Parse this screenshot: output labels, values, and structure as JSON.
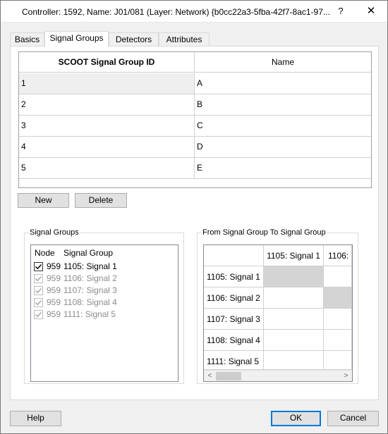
{
  "window": {
    "title": "Controller: 1592, Name: J01/081 (Layer: Network) {b0cc22a3-5fba-42f7-8ac1-97...",
    "help_glyph": "?",
    "close_glyph": "✕"
  },
  "tabs": [
    {
      "label": "Basics",
      "active": false
    },
    {
      "label": "Signal Groups",
      "active": true
    },
    {
      "label": "Detectors",
      "active": false
    },
    {
      "label": "Attributes",
      "active": false
    }
  ],
  "grid": {
    "columns": [
      "SCOOT Signal Group ID",
      "Name"
    ],
    "rows": [
      {
        "id": "1",
        "name": "A",
        "selected": true
      },
      {
        "id": "2",
        "name": "B",
        "selected": false
      },
      {
        "id": "3",
        "name": "C",
        "selected": false
      },
      {
        "id": "4",
        "name": "D",
        "selected": false
      },
      {
        "id": "5",
        "name": "E",
        "selected": false
      }
    ]
  },
  "actions": {
    "new_label": "New",
    "delete_label": "Delete"
  },
  "signal_groups": {
    "title": "Signal Groups",
    "headers": {
      "node": "Node",
      "signal_group": "Signal Group"
    },
    "items": [
      {
        "node": "959",
        "name": "1105: Signal 1",
        "checked": true,
        "enabled": true
      },
      {
        "node": "959",
        "name": "1106: Signal 2",
        "checked": true,
        "enabled": false
      },
      {
        "node": "959",
        "name": "1107: Signal 3",
        "checked": true,
        "enabled": false
      },
      {
        "node": "959",
        "name": "1108: Signal 4",
        "checked": true,
        "enabled": false
      },
      {
        "node": "959",
        "name": "1111: Signal 5",
        "checked": true,
        "enabled": false
      }
    ]
  },
  "matrix": {
    "title": "From Signal Group To Signal Group",
    "col_headers": [
      "1105: Signal 1",
      "1106: "
    ],
    "row_headers": [
      "1105: Signal 1",
      "1106: Signal 2",
      "1107: Signal 3",
      "1108: Signal 4",
      "1111: Signal 5"
    ],
    "scroll_left": "<",
    "scroll_right": ">"
  },
  "footer": {
    "help_label": "Help",
    "ok_label": "OK",
    "cancel_label": "Cancel"
  }
}
